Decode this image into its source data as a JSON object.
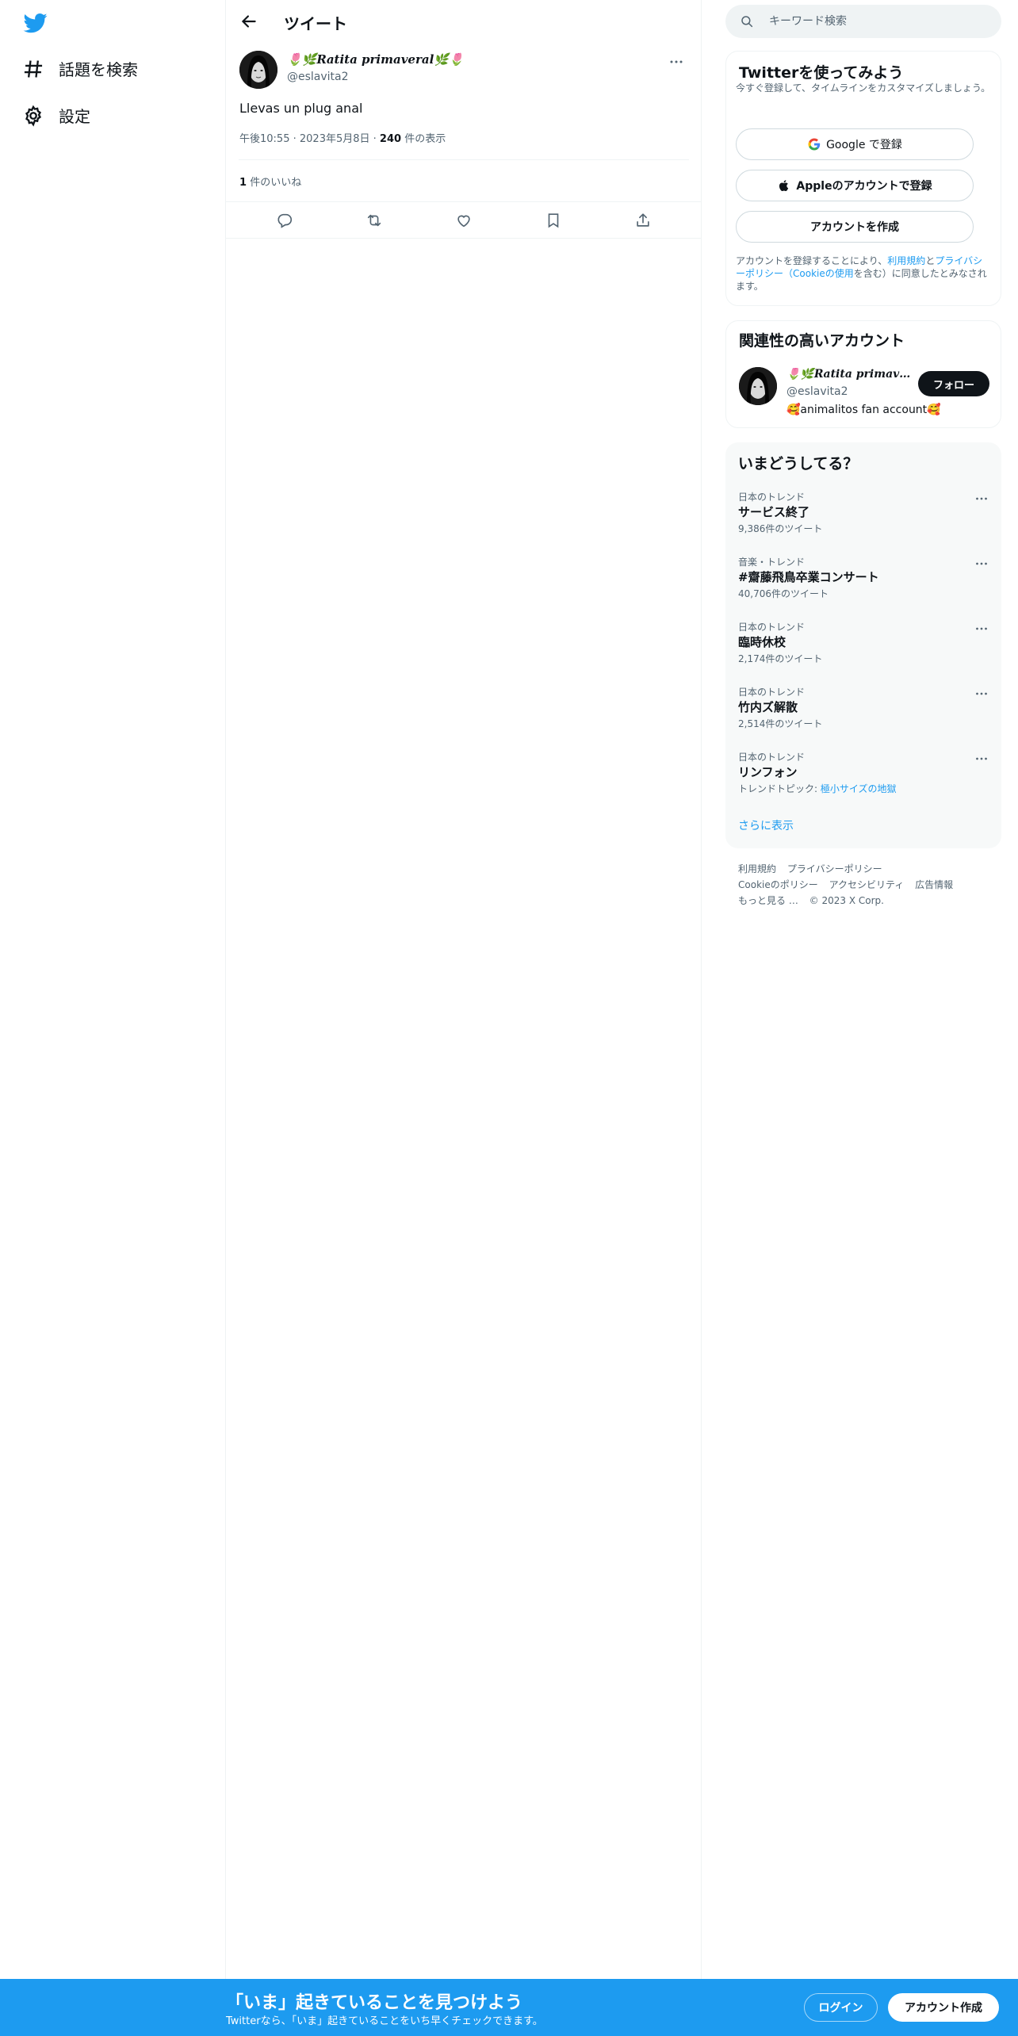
{
  "nav": {
    "explore_label": "話題を検索",
    "settings_label": "設定"
  },
  "header": {
    "title": "ツイート"
  },
  "tweet": {
    "author_name": "🌷🌿𝑹𝒂𝒕𝒊𝒕𝒂 𝒑𝒓𝒊𝒎𝒂𝒗𝒆𝒓𝒂𝒍🌿🌷",
    "author_handle": "@eslavita2",
    "text": "Llevas un plug anal",
    "time": "午後10:55",
    "date": "2023年5月8日",
    "views_count": "240",
    "views_label": "件の表示",
    "likes_count": "1",
    "likes_label": "件のいいね"
  },
  "search": {
    "placeholder": "キーワード検索"
  },
  "signup_card": {
    "title": "Twitterを使ってみよう",
    "subtitle": "今すぐ登録して、タイムラインをカスタマイズしましょう。",
    "google_label": "Google で登録",
    "apple_label": "Appleのアカウントで登録",
    "create_label": "アカウントを作成",
    "legal_prefix": "アカウントを登録することにより、",
    "terms_link": "利用規約",
    "and": "と",
    "privacy_link": "プライバシーポリシー（Cookieの使用",
    "legal_suffix": "を含む）に同意したとみなされます。"
  },
  "relevant": {
    "title": "関連性の高いアカウント",
    "name": "🌷🌿𝑹𝒂𝒕𝒊𝒕𝒂 𝒑𝒓𝒊𝒎𝒂𝒗𝒆𝒓𝒂𝒍🌿🌷",
    "handle": "@eslavita2",
    "bio": "🥰animalitos fan account🥰",
    "follow_label": "フォロー"
  },
  "trends": {
    "title": "いまどうしてる？",
    "items": [
      {
        "context": "日本のトレンド",
        "name": "サービス終了",
        "count": "9,386件のツイート"
      },
      {
        "context": "音楽・トレンド",
        "name": "#齋藤飛鳥卒業コンサート",
        "count": "40,706件のツイート"
      },
      {
        "context": "日本のトレンド",
        "name": "臨時休校",
        "count": "2,174件のツイート"
      },
      {
        "context": "日本のトレンド",
        "name": "竹内ズ解散",
        "count": "2,514件のツイート"
      },
      {
        "context": "日本のトレンド",
        "name": "リンフォン",
        "count_prefix": "トレンドトピック: ",
        "count_link": "極小サイズの地獄"
      }
    ],
    "show_more": "さらに表示"
  },
  "footer": {
    "terms": "利用規約",
    "privacy": "プライバシーポリシー",
    "cookie": "Cookieのポリシー",
    "accessibility": "アクセシビリティ",
    "ads": "広告情報",
    "more": "もっと見る …",
    "copyright": "© 2023 X Corp."
  },
  "bottom_bar": {
    "title": "「いま」起きていることを見つけよう",
    "subtitle": "Twitterなら、「いま」起きていることをいち早くチェックできます。",
    "login_label": "ログイン",
    "signup_label": "アカウント作成"
  },
  "colors": {
    "accent": "#1d9bf0",
    "text": "#0f1419",
    "muted": "#536471"
  }
}
